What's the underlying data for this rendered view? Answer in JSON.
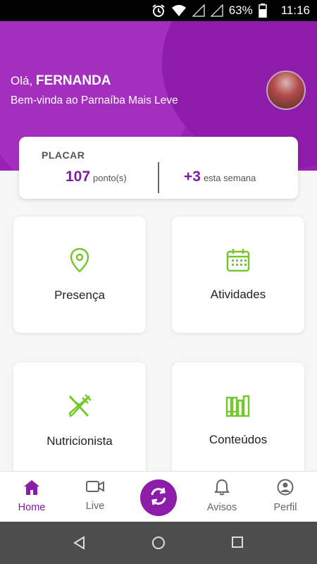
{
  "status": {
    "battery": "63%",
    "time": "11:16"
  },
  "header": {
    "greeting_prefix": "Olá,",
    "user_name": "FERNANDA",
    "welcome": "Bem-vinda ao Parnaíba Mais Leve"
  },
  "score": {
    "title": "PLACAR",
    "points": "107",
    "points_unit": "ponto(s)",
    "week_points": "+3",
    "week_label": "esta semana"
  },
  "tiles": [
    {
      "label": "Presença",
      "icon": "location-pin-icon"
    },
    {
      "label": "Atividades",
      "icon": "calendar-icon"
    },
    {
      "label": "Nutricionista",
      "icon": "fork-knife-icon"
    },
    {
      "label": "Conteúdos",
      "icon": "books-icon"
    }
  ],
  "nav": [
    {
      "label": "Home",
      "icon": "home-icon",
      "active": true
    },
    {
      "label": "Live",
      "icon": "video-camera-icon"
    },
    {
      "label": "",
      "icon": "sync-icon"
    },
    {
      "label": "Avisos",
      "icon": "bell-icon"
    },
    {
      "label": "Perfil",
      "icon": "profile-icon"
    }
  ],
  "colors": {
    "primary": "#9b21b6",
    "accent_green": "#76c72d",
    "text_purple": "#7b1fa2"
  }
}
